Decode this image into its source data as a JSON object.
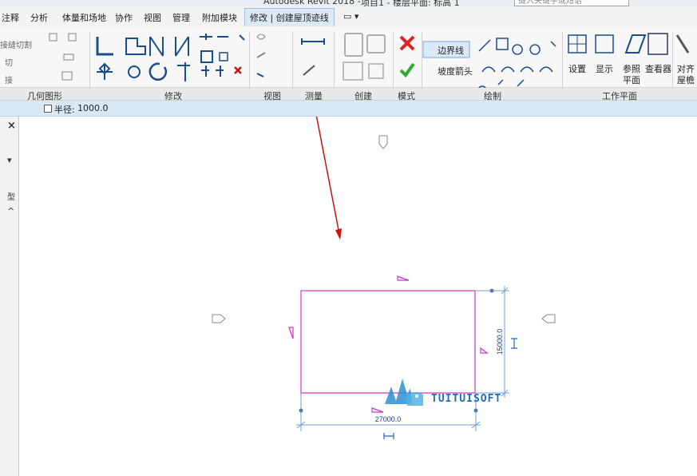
{
  "title_bar": {
    "app_title": "Autodesk Revit 2018 -",
    "document_title": "项目1 - 楼层平面: 标高 1",
    "search_placeholder": "键入关键字或短语"
  },
  "menu": {
    "tabs": [
      "注释",
      "分析",
      "体量和场地",
      "协作",
      "视图",
      "管理",
      "附加模块"
    ],
    "active_tab": "修改 | 创建屋顶迹线"
  },
  "ribbon": {
    "groups": {
      "geometry": "几何图形",
      "modify": "修改",
      "view": "视图",
      "measure": "测量",
      "create": "创建",
      "mode": "模式",
      "draw": "绘制",
      "workplane": "工作平面"
    },
    "geometry_items": [
      "接缝切割",
      "切",
      "接"
    ],
    "boundary_line_label": "边界线",
    "slope_arrow_label": "坡度箭头",
    "set_label": "设置",
    "show_label": "显示",
    "ref_plane_label": "参照",
    "ref_plane_label2": "平面",
    "viewer_label": "查看器",
    "align_label": "对齐",
    "align_label2": "屋檐"
  },
  "options_bar": {
    "radius_label": "半径:",
    "radius_value": "1000.0"
  },
  "left_panel": {
    "close": "×",
    "dropdown": "▾",
    "type_char": "型",
    "caret_up": "^"
  },
  "drawing": {
    "dim_width": "27000.0",
    "dim_height": "15000.0"
  },
  "watermark": {
    "text": "TUITUISOFT"
  },
  "colors": {
    "roof_line": "#cc33cc",
    "dimension": "#2266cc",
    "arrow": "#cc1111",
    "active_tab": "#dde9f5"
  }
}
